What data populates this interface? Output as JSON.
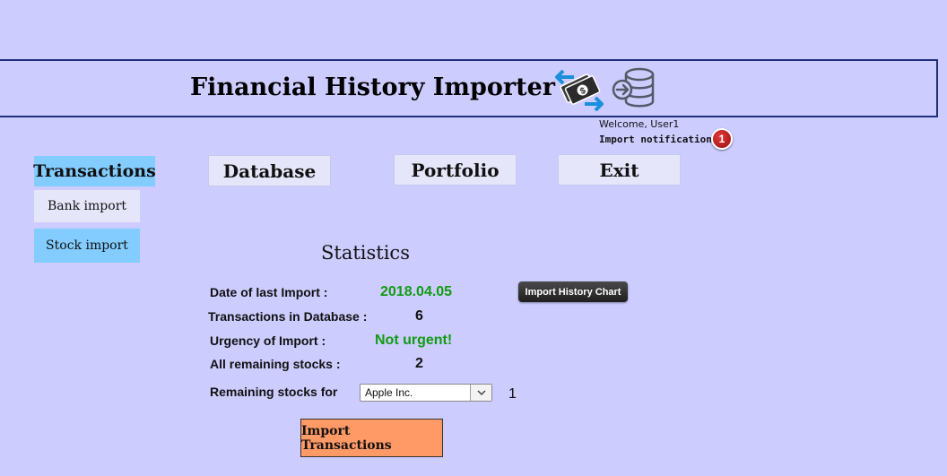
{
  "header": {
    "title": "Financial History Importer",
    "icons": [
      "money-transfer-icon",
      "database-import-icon"
    ]
  },
  "user": {
    "welcome": "Welcome, User1",
    "notification_label": "Import notification",
    "notification_count": "1"
  },
  "nav": {
    "transactions": "Transactions",
    "database": "Database",
    "portfolio": "Portfolio",
    "exit": "Exit"
  },
  "sidebar": {
    "bank_import": "Bank import",
    "stock_import": "Stock import"
  },
  "stats": {
    "title": "Statistics",
    "last_import_label": "Date of last Import :",
    "last_import_value": "2018.04.05",
    "transactions_label": "Transactions in Database :",
    "transactions_value": "6",
    "urgency_label": "Urgency of Import :",
    "urgency_value": "Not urgent!",
    "remaining_label": "All remaining stocks :",
    "remaining_value": "2",
    "remaining_for_label": "Remaining stocks for",
    "remaining_for_selected": "Apple Inc.",
    "remaining_for_value": "1",
    "chart_button": "Import History Chart"
  },
  "actions": {
    "import_button": "Import Transactions"
  },
  "colors": {
    "background": "#ccccff",
    "active_nav": "#82ccff",
    "import_button": "#ff9966",
    "ok_green": "#129b12",
    "badge_red": "#c0141a"
  }
}
